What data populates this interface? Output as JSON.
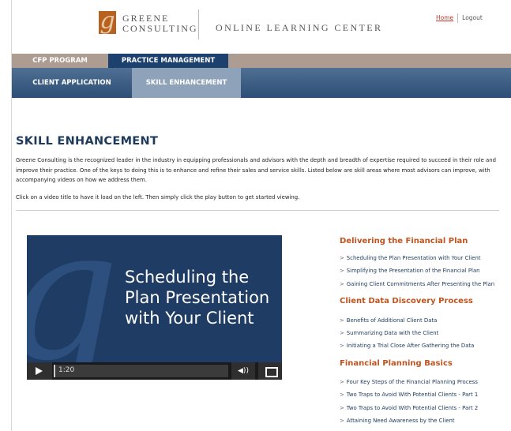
{
  "header": {
    "logo_letter": "g",
    "logo_line1": "Greene",
    "logo_line2": "Consulting",
    "center_title": "ONLINE LEARNING CENTER",
    "home_link": "Home",
    "logout_link": "Logout"
  },
  "nav_primary": [
    {
      "label": "CFP PROGRAM"
    },
    {
      "label": "PRACTICE MANAGEMENT"
    }
  ],
  "nav_secondary": [
    {
      "label": "CLIENT APPLICATION"
    },
    {
      "label": "SKILL ENHANCEMENT"
    }
  ],
  "content": {
    "title": "SKILL ENHANCEMENT",
    "intro": "Greene Consulting is the recognized leader in the industry in equipping professionals and advisors with the depth and breadth of expertise required to succeed in their role and improve their practice. One of the keys to doing this is to enhance and refine their sales and service skills. Listed below are skill areas where most advisors can improve, with accompanying videos on how we address them.",
    "instructions": "Click on a video title to have it load on the left. Then simply click the play button to get started viewing."
  },
  "video": {
    "title": "Scheduling the Plan Presentation with Your Client",
    "time": "1:20",
    "volume_glyph": "◀))"
  },
  "categories": [
    {
      "name": "Delivering the Financial Plan",
      "links": [
        "Scheduling the Plan Presentation with Your Client",
        "Simplifying the Presentation of the Financial Plan",
        "Gaining Client Commitments After Presenting the Plan"
      ]
    },
    {
      "name": "Client Data Discovery Process",
      "links": [
        "Benefits of Additional Client Data",
        "Summarizing Data with the Client",
        "Initiating a Trial Close After Gathering the Data"
      ]
    },
    {
      "name": "Financial Planning Basics",
      "links": [
        "Four Key Steps of the Financial Planning Process",
        "Two Traps to Avoid With Potential Clients - Part 1",
        "Two Traps to Avoid With Potential Clients - Part 2",
        "Attaining Need Awareness by the Client"
      ]
    }
  ],
  "link_arrow": ">",
  "colors": {
    "nav_primary_bg": "#ad9c91",
    "nav_active": "#1d416e",
    "category_heading": "#c0531e",
    "link_text": "#1d3a5c",
    "title_text": "#1d3a5c"
  }
}
